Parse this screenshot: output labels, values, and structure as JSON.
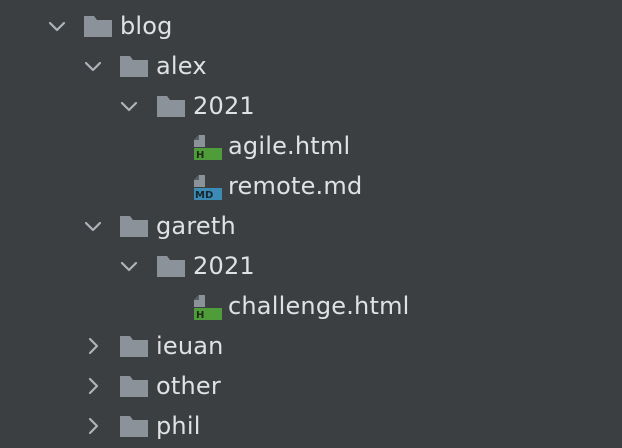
{
  "tree": {
    "blog": {
      "label": "blog",
      "expanded": true
    },
    "alex": {
      "label": "alex",
      "expanded": true
    },
    "alex_2021": {
      "label": "2021",
      "expanded": true
    },
    "agile": {
      "label": "agile.html",
      "type": "html",
      "badge": "H"
    },
    "remote": {
      "label": "remote.md",
      "type": "markdown",
      "badge": "MD"
    },
    "gareth": {
      "label": "gareth",
      "expanded": true
    },
    "gareth_2021": {
      "label": "2021",
      "expanded": true
    },
    "challenge": {
      "label": "challenge.html",
      "type": "html",
      "badge": "H"
    },
    "ieuan": {
      "label": "ieuan",
      "expanded": false
    },
    "other": {
      "label": "other",
      "expanded": false
    },
    "phil": {
      "label": "phil",
      "expanded": false
    }
  },
  "colors": {
    "background": "#3c3f41",
    "text": "#dfe1e5",
    "folder": "#8c9299",
    "html_badge": "#4f9d3a",
    "md_badge": "#3b8bb5"
  },
  "icons": {
    "folder": "folder-icon",
    "chevron_down": "chevron-down-icon",
    "chevron_right": "chevron-right-icon",
    "html_file": "html-file-icon",
    "md_file": "markdown-file-icon"
  }
}
